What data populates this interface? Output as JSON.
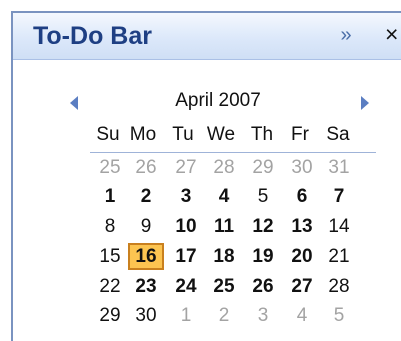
{
  "todo_bar": {
    "title": "To-Do Bar",
    "expand_glyph": "»",
    "close_glyph": "×",
    "icons": {
      "prev": "chevron-left-icon",
      "next": "chevron-right-icon"
    }
  },
  "calendar": {
    "month_label": "April 2007",
    "weekdays": [
      "Su",
      "Mo",
      "Tu",
      "We",
      "Th",
      "Fr",
      "Sa"
    ],
    "weeks": [
      [
        {
          "d": "25",
          "m": true
        },
        {
          "d": "26",
          "m": true
        },
        {
          "d": "27",
          "m": true
        },
        {
          "d": "28",
          "m": true
        },
        {
          "d": "29",
          "m": true
        },
        {
          "d": "30",
          "m": true
        },
        {
          "d": "31",
          "m": true
        }
      ],
      [
        {
          "d": "1",
          "b": true
        },
        {
          "d": "2",
          "b": true
        },
        {
          "d": "3",
          "b": true
        },
        {
          "d": "4",
          "b": true
        },
        {
          "d": "5"
        },
        {
          "d": "6",
          "b": true
        },
        {
          "d": "7",
          "b": true
        }
      ],
      [
        {
          "d": "8"
        },
        {
          "d": "9"
        },
        {
          "d": "10",
          "b": true
        },
        {
          "d": "11",
          "b": true
        },
        {
          "d": "12",
          "b": true
        },
        {
          "d": "13",
          "b": true
        },
        {
          "d": "14"
        }
      ],
      [
        {
          "d": "15"
        },
        {
          "d": "16",
          "today": true
        },
        {
          "d": "17",
          "b": true
        },
        {
          "d": "18",
          "b": true
        },
        {
          "d": "19",
          "b": true
        },
        {
          "d": "20",
          "b": true
        },
        {
          "d": "21"
        }
      ],
      [
        {
          "d": "22"
        },
        {
          "d": "23",
          "b": true
        },
        {
          "d": "24",
          "b": true
        },
        {
          "d": "25",
          "b": true
        },
        {
          "d": "26",
          "b": true
        },
        {
          "d": "27",
          "b": true
        },
        {
          "d": "28"
        }
      ],
      [
        {
          "d": "29"
        },
        {
          "d": "30"
        },
        {
          "d": "1",
          "m": true
        },
        {
          "d": "2",
          "m": true
        },
        {
          "d": "3",
          "m": true
        },
        {
          "d": "4",
          "m": true
        },
        {
          "d": "5",
          "m": true
        }
      ]
    ],
    "colors": {
      "today_fill": "#fcc451",
      "today_border": "#c9801f",
      "header_text": "#1e3f83"
    }
  }
}
